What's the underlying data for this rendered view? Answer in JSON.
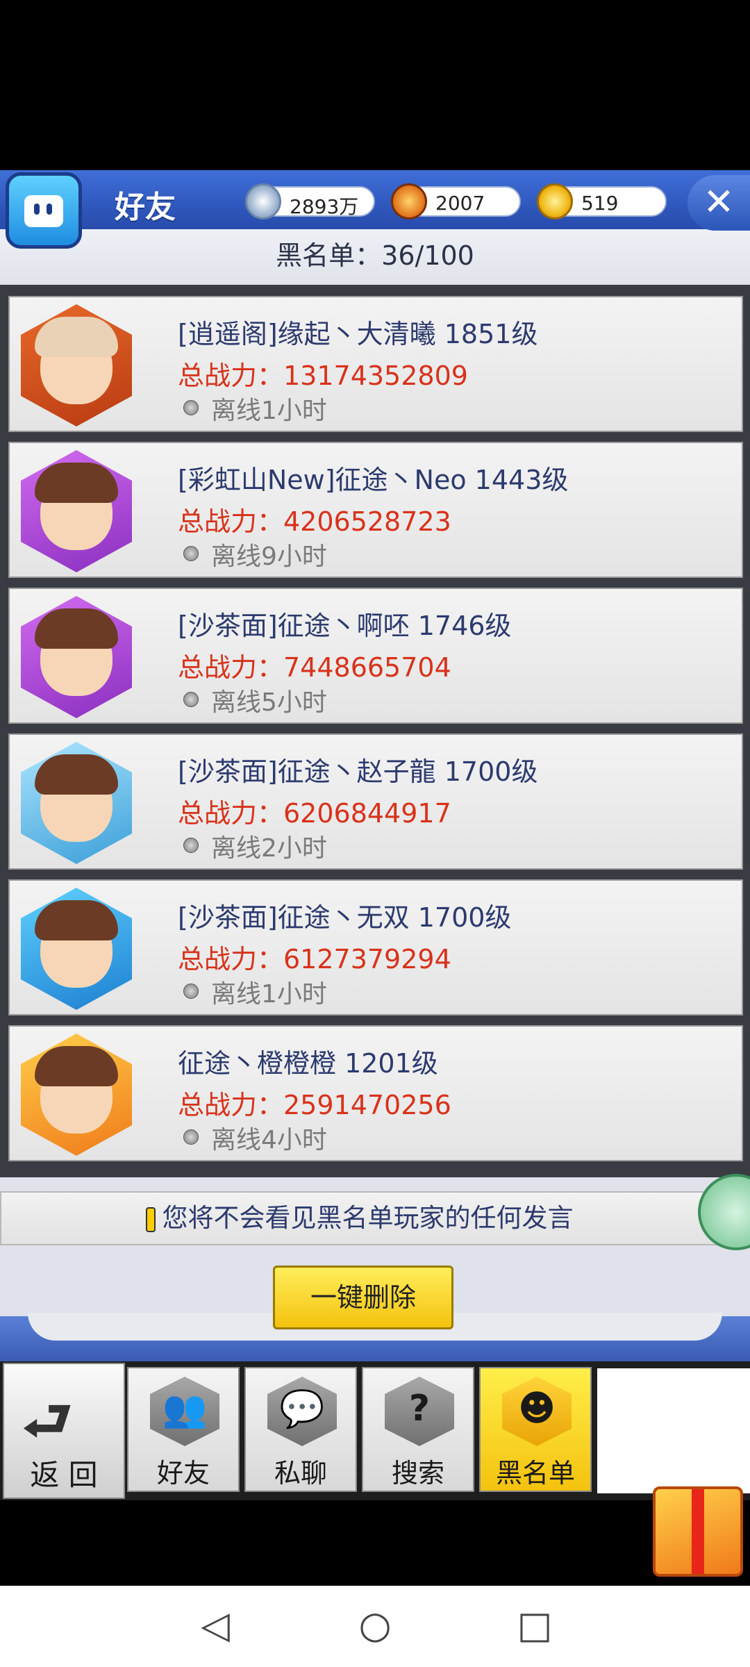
{
  "header": {
    "title": "好友",
    "close_label": "✕",
    "blacklist_count": "黑名单：36/100"
  },
  "currencies": [
    {
      "icon": "silver-coin-icon",
      "value": "2893万"
    },
    {
      "icon": "bronze-medal-icon",
      "value": "2007"
    },
    {
      "icon": "gold-coin-icon",
      "value": "519"
    }
  ],
  "blacklist": [
    {
      "name": "[逍遥阁]缘起丶大清曦 1851级",
      "power": "总战力：13174352809",
      "status": "离线1小时"
    },
    {
      "name": "[彩虹山New]征途丶Neo 1443级",
      "power": "总战力：4206528723",
      "status": "离线9小时"
    },
    {
      "name": "[沙茶面]征途丶啊呸 1746级",
      "power": "总战力：7448665704",
      "status": "离线5小时"
    },
    {
      "name": "[沙茶面]征途丶赵子龍 1700级",
      "power": "总战力：6206844917",
      "status": "离线2小时"
    },
    {
      "name": "[沙茶面]征途丶无双 1700级",
      "power": "总战力：6127379294",
      "status": "离线1小时"
    },
    {
      "name": "征途丶橙橙橙 1201级",
      "power": "总战力：2591470256",
      "status": "离线4小时"
    }
  ],
  "notice": "您将不会看见黑名单玩家的任何发言",
  "delete_button": "一键删除",
  "back_button": "返 回",
  "tabs": [
    {
      "label": "好友",
      "icon": "friends-icon"
    },
    {
      "label": "私聊",
      "icon": "chat-icon"
    },
    {
      "label": "搜索",
      "icon": "search-icon"
    },
    {
      "label": "黑名单",
      "icon": "devil-icon"
    }
  ],
  "colors": {
    "accent_blue": "#2d54b8",
    "power_red": "#d8321a",
    "active_tab_yellow": "#f4c20e"
  }
}
